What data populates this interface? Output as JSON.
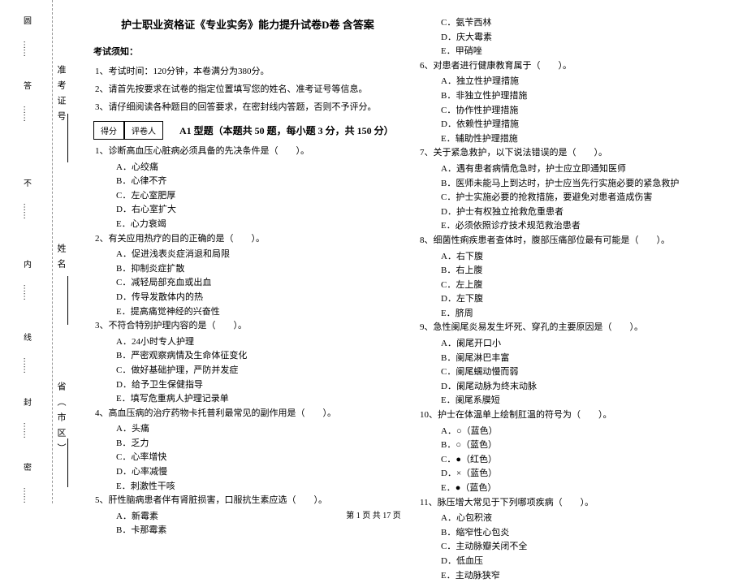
{
  "binding": {
    "labels": [
      "圆",
      "答",
      "不",
      "内",
      "线",
      "封",
      "密"
    ],
    "dotSegments": [
      "……",
      "……",
      "……",
      "……",
      "……",
      "……",
      "……"
    ]
  },
  "sideInfo": {
    "labels": [
      "准考证号",
      "姓名",
      "省（市区）"
    ]
  },
  "title": "护士职业资格证《专业实务》能力提升试卷D卷 含答案",
  "noticeHead": "考试须知：",
  "instructions": [
    "1、考试时间：120分钟，本卷满分为380分。",
    "2、请首先按要求在试卷的指定位置填写您的姓名、准考证号等信息。",
    "3、请仔细阅读各种题目的回答要求，在密封线内答题，否则不予评分。"
  ],
  "scoreBox": {
    "left": "得分",
    "right": "评卷人"
  },
  "sectionTitle": "A1 型题（本题共 50 题，每小题 3 分，共 150 分）",
  "questionsLeft": [
    {
      "q": "1、诊断高血压心脏病必须具备的先决条件是（　　）。",
      "opts": [
        "A．心绞痛",
        "B．心律不齐",
        "C．左心室肥厚",
        "D．右心室扩大",
        "E．心力衰竭"
      ]
    },
    {
      "q": "2、有关应用热疗的目的正确的是（　　）。",
      "opts": [
        "A．促进浅表炎症消退和局限",
        "B．抑制炎症扩散",
        "C．减轻局部充血或出血",
        "D．传导发散体内的热",
        "E．提高痛觉神经的兴奋性"
      ]
    },
    {
      "q": "3、不符合特别护理内容的是（　　）。",
      "opts": [
        "A．24小时专人护理",
        "B．严密观察病情及生命体征变化",
        "C．做好基础护理，严防并发症",
        "D．给予卫生保健指导",
        "E．填写危重病人护理记录单"
      ]
    },
    {
      "q": "4、高血压病的治疗药物卡托普利最常见的副作用是（　　）。",
      "opts": [
        "A．头痛",
        "B．乏力",
        "C．心率增快",
        "D．心率减慢",
        "E．刺激性干咳"
      ]
    },
    {
      "q": "5、肝性脑病患者伴有肾脏损害，口服抗生素应选（　　）。",
      "opts": [
        "A．新霉素",
        "B．卡那霉素"
      ]
    }
  ],
  "questionsRight": [
    {
      "q": "",
      "opts": [
        "C．氨苄西林",
        "D．庆大霉素",
        "E．甲硝唑"
      ]
    },
    {
      "q": "6、对患者进行健康教育属于（　　）。",
      "opts": [
        "A．独立性护理措施",
        "B．非独立性护理措施",
        "C．协作性护理措施",
        "D．依赖性护理措施",
        "E．辅助性护理措施"
      ]
    },
    {
      "q": "7、关于紧急救护，以下说法错误的是（　　）。",
      "opts": [
        "A．遇有患者病情危急时，护士应立即通知医师",
        "B．医师未能马上到达时，护士应当先行实施必要的紧急救护",
        "C．护士实施必要的抢救措施，要避免对患者造成伤害",
        "D．护士有权独立抢救危重患者",
        "E．必须依照诊疗技术规范救治患者"
      ]
    },
    {
      "q": "8、细菌性痢疾患者查体时，腹部压痛部位最有可能是（　　）。",
      "opts": [
        "A．右下腹",
        "B．右上腹",
        "C．左上腹",
        "D．左下腹",
        "E．脐周"
      ]
    },
    {
      "q": "9、急性阑尾炎易发生坏死、穿孔的主要原因是（　　）。",
      "opts": [
        "A．阑尾开口小",
        "B．阑尾淋巴丰富",
        "C．阑尾蠕动慢而弱",
        "D．阑尾动脉为终末动脉",
        "E．阑尾系膜短"
      ]
    },
    {
      "q": "10、护士在体温单上绘制肛温的符号为（　　）。",
      "opts": [
        "A．○（蓝色）",
        "B．○（蓝色）",
        "C．●（红色）",
        "D．×（蓝色）",
        "E．●（蓝色）"
      ]
    },
    {
      "q": "11、脉压增大常见于下列哪项疾病（　　）。",
      "opts": [
        "A．心包积液",
        "B．缩窄性心包炎",
        "C．主动脉瓣关闭不全",
        "D．低血压",
        "E．主动脉狭窄"
      ]
    }
  ],
  "footer": "第 1 页 共 17 页"
}
